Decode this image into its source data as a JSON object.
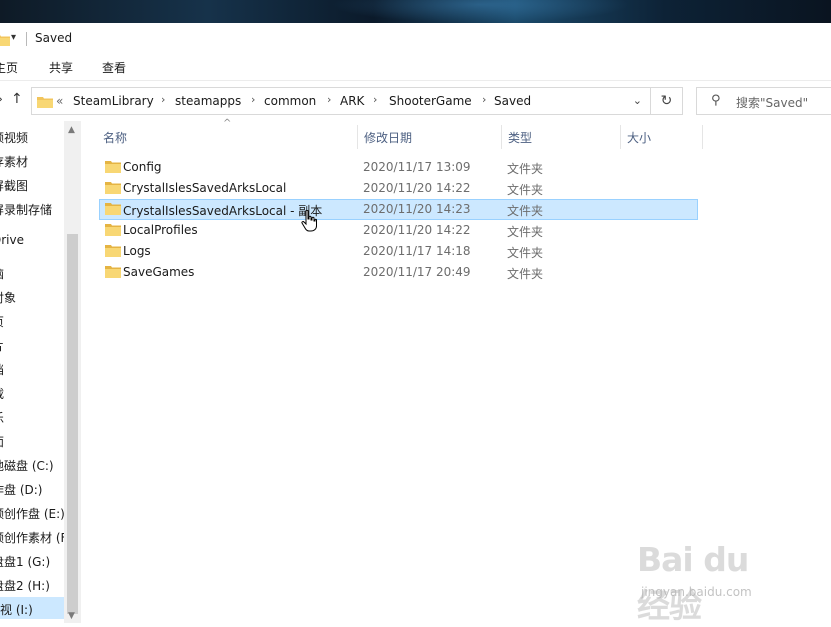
{
  "window": {
    "title": "Saved"
  },
  "ribbon": {
    "tabs": [
      "主页",
      "共享",
      "查看"
    ]
  },
  "address": {
    "overflow": "«",
    "crumbs": [
      "SteamLibrary",
      "steamapps",
      "common",
      "ARK",
      "ShooterGame",
      "Saved"
    ]
  },
  "search": {
    "placeholder": "搜索\"Saved\""
  },
  "navpane": {
    "items": [
      "频视频",
      "存素材",
      "屏截图",
      "屏录制存储",
      "Drive",
      "脑",
      "对象",
      "页",
      "片",
      "档",
      "载",
      "乐",
      "面",
      "地磁盘 (C:)",
      "作盘 (D:)",
      "频创作盘 (E:)",
      "频创作素材 (F",
      "盘盘1 (G:)",
      "盘盘2 (H:)",
      "视 (I:)"
    ]
  },
  "columns": {
    "name": "名称",
    "date": "修改日期",
    "type": "类型",
    "size": "大小"
  },
  "files": [
    {
      "name": "Config",
      "date": "2020/11/17 13:09",
      "type": "文件夹"
    },
    {
      "name": "CrystalIslesSavedArksLocal",
      "date": "2020/11/20 14:22",
      "type": "文件夹"
    },
    {
      "name": "CrystalIslesSavedArksLocal - 副本",
      "date": "2020/11/20 14:23",
      "type": "文件夹"
    },
    {
      "name": "LocalProfiles",
      "date": "2020/11/20 14:22",
      "type": "文件夹"
    },
    {
      "name": "Logs",
      "date": "2020/11/17 14:18",
      "type": "文件夹"
    },
    {
      "name": "SaveGames",
      "date": "2020/11/17 20:49",
      "type": "文件夹"
    }
  ],
  "selected_index": 2,
  "watermark": {
    "brand": "Bai du 经验",
    "url": "jingyan.baidu.com"
  },
  "colors": {
    "accent": "#cce8ff",
    "folder": "#f2c55c",
    "header_text": "#4d6082"
  }
}
